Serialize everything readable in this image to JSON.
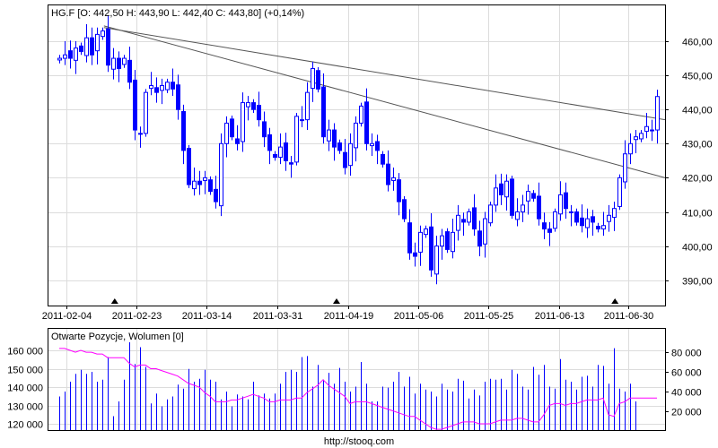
{
  "chart_data": [
    {
      "type": "candlestick",
      "title": "HG.F [O: 442,50  H: 443,90  L: 442,40  C: 443,80] (+0,14%)",
      "ylim": [
        383,
        470
      ],
      "y_ticks": [
        "390,00",
        "400,00",
        "410,00",
        "420,00",
        "430,00",
        "440,00",
        "450,00",
        "460,00"
      ],
      "y_tick_values": [
        390,
        400,
        410,
        420,
        430,
        440,
        450,
        460
      ],
      "x_ticks": [
        "2011-02-04",
        "2011-02-23",
        "2011-03-14",
        "2011-03-31",
        "2011-04-19",
        "2011-05-06",
        "2011-05-25",
        "2011-06-13",
        "2011-06-30"
      ],
      "x_tick_index": [
        1.3,
        14.3,
        27.3,
        40.5,
        53.7,
        66.7,
        79.7,
        92.8,
        105.7
      ],
      "marker_index": [
        10.3,
        51.5,
        103.2
      ],
      "close": [
        455,
        456,
        455,
        458,
        457,
        461,
        456,
        462,
        463,
        453,
        455,
        452,
        455,
        448,
        434,
        433,
        445,
        447,
        445,
        447,
        448,
        446,
        440,
        428,
        418,
        419,
        418,
        420,
        416,
        413,
        430,
        436,
        432,
        430,
        442,
        442,
        440,
        437,
        432,
        428,
        426,
        429,
        425,
        424,
        438,
        437,
        445,
        452,
        446,
        432,
        434,
        429,
        428,
        423,
        430,
        436,
        441,
        430,
        430,
        428,
        424,
        418,
        420,
        413,
        408,
        398,
        397,
        404,
        405,
        393,
        400,
        403,
        399,
        404,
        409,
        407,
        410,
        405,
        400,
        408,
        412,
        417,
        415,
        419,
        409,
        410,
        412,
        416,
        414,
        408,
        405,
        404,
        410,
        415,
        411,
        410,
        407,
        406,
        408,
        407,
        405,
        406,
        409,
        411,
        420,
        427,
        430,
        432,
        433,
        435,
        434,
        443.8
      ],
      "trendlines": [
        {
          "from": [
            8.3,
            464
          ],
          "to": [
            112.5,
            437
          ]
        },
        {
          "from": [
            8.3,
            464.5
          ],
          "to": [
            112.5,
            420
          ]
        }
      ]
    },
    {
      "type": "bar+line",
      "title": "Otwarte Pozycje, Wolumen [0]",
      "left_axis_ticks": [
        "120 000",
        "130 000",
        "140 000",
        "150 000",
        "160 000"
      ],
      "left_axis_values": [
        120000,
        130000,
        140000,
        150000,
        160000
      ],
      "right_axis_ticks": [
        "20 000",
        "40 000",
        "60 000",
        "80 000"
      ],
      "right_axis_values": [
        20000,
        40000,
        60000,
        80000
      ],
      "volume_thousands": [
        35,
        40,
        50,
        58,
        62,
        58,
        60,
        50,
        52,
        75,
        15,
        30,
        52,
        90,
        68,
        85,
        65,
        28,
        38,
        25,
        32,
        35,
        47,
        43,
        63,
        50,
        53,
        62,
        52,
        50,
        32,
        40,
        25,
        37,
        35,
        32,
        50,
        36,
        38,
        33,
        38,
        48,
        60,
        62,
        60,
        75,
        76,
        45,
        67,
        52,
        59,
        48,
        64,
        50,
        40,
        45,
        70,
        48,
        30,
        30,
        45,
        44,
        50,
        60,
        45,
        55,
        38,
        48,
        42,
        40,
        35,
        48,
        42,
        40,
        53,
        51,
        33,
        42,
        36,
        50,
        53,
        52,
        53,
        42,
        62,
        58,
        45,
        42,
        65,
        57,
        67,
        45,
        43,
        73,
        52,
        50,
        42,
        55,
        56,
        45,
        67,
        66,
        48,
        84,
        43,
        40,
        48,
        30
      ],
      "open_interest_thousands": [
        161,
        161,
        160,
        159,
        160,
        159,
        159,
        158,
        158,
        156,
        156,
        156,
        156,
        153,
        151,
        152,
        152,
        150,
        150,
        149,
        148,
        147,
        146,
        144,
        142,
        141,
        140,
        137,
        135,
        132,
        132,
        132,
        133,
        133,
        134,
        135,
        136,
        135,
        134,
        132,
        132,
        133,
        133,
        133,
        134,
        134,
        137,
        139,
        141,
        144,
        141,
        139,
        137,
        135,
        131,
        132,
        132,
        132,
        131,
        130,
        129,
        128,
        127,
        126,
        125,
        124,
        124,
        122,
        120,
        118,
        117,
        117,
        118,
        119,
        120,
        121,
        121,
        121,
        120,
        120,
        120,
        121,
        122,
        122,
        122,
        123,
        123,
        122,
        121,
        121,
        125,
        130,
        131,
        131,
        130,
        131,
        131,
        132,
        133,
        133,
        133,
        134,
        125,
        124,
        131,
        132,
        134,
        134,
        134,
        134,
        134,
        134
      ]
    }
  ],
  "footer": "http://stooq.com",
  "colors": {
    "candle": "#0000ff",
    "oi_line": "#ff00ff",
    "grid": "#dcdcdc",
    "trendline": "#555555"
  }
}
